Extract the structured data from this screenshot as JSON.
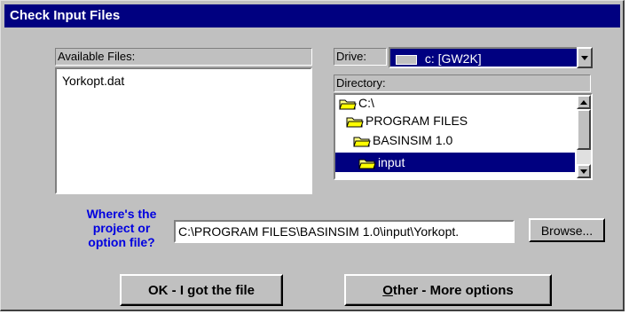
{
  "window": {
    "title": "Check Input Files"
  },
  "files": {
    "label": "Available Files:",
    "items": [
      "Yorkopt.dat"
    ]
  },
  "drive": {
    "label": "Drive:",
    "selected": "c: [GW2K]"
  },
  "directory": {
    "label": "Directory:",
    "items": [
      {
        "name": "C:\\",
        "selected": false
      },
      {
        "name": "PROGRAM FILES",
        "selected": false
      },
      {
        "name": "BASINSIM 1.0",
        "selected": false
      },
      {
        "name": "input",
        "selected": true
      }
    ]
  },
  "prompt": {
    "line1": "Where's the",
    "line2": "project or",
    "line3": "option file?"
  },
  "path_input": {
    "value": "C:\\PROGRAM FILES\\BASINSIM 1.0\\input\\Yorkopt."
  },
  "buttons": {
    "browse": "Browse...",
    "ok_pre": "OK - I ",
    "ok_key": "g",
    "ok_post": "ot the file",
    "other_key": "O",
    "other_post": "ther - More options"
  },
  "colors": {
    "title_bar": "#000080",
    "selection": "#000080",
    "prompt_text": "#0000e0",
    "face": "#c0c0c0"
  }
}
